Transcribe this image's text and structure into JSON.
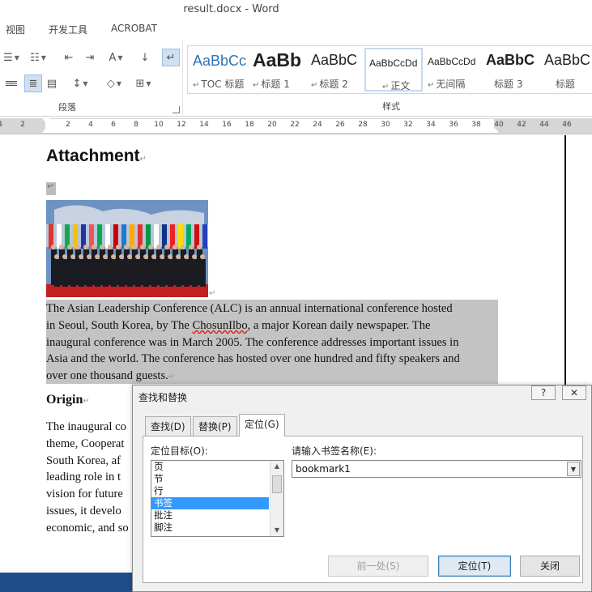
{
  "window": {
    "title": "result.docx - Word"
  },
  "ribbon_tabs": [
    "视图",
    "开发工具",
    "ACROBAT"
  ],
  "paragraph_group": {
    "label": "段落"
  },
  "styles_group": {
    "label": "样式",
    "items": [
      {
        "sample": "AaBbCc",
        "name": "TOC 标题"
      },
      {
        "sample": "AaBb",
        "name": "标题 1"
      },
      {
        "sample": "AaBbC",
        "name": "标题 2"
      },
      {
        "sample": "AaBbCcDd",
        "name": "正文"
      },
      {
        "sample": "AaBbCcDd",
        "name": "无间隔"
      },
      {
        "sample": "AaBbC",
        "name": "标题 3"
      },
      {
        "sample": "AaBbC",
        "name": "标题"
      }
    ]
  },
  "ruler": {
    "ticks": [
      "4",
      "2",
      "2",
      "4",
      "6",
      "8",
      "10",
      "12",
      "14",
      "16",
      "18",
      "20",
      "22",
      "24",
      "26",
      "28",
      "30",
      "32",
      "34",
      "36",
      "38",
      "40",
      "42",
      "44",
      "46"
    ]
  },
  "document": {
    "heading": "Attachment",
    "para1_lines": [
      "The Asian Leadership Conference (ALC) is an annual international conference hosted",
      "in Seoul, South Korea, by The ",
      "inaugural conference was in March 2005. The conference addresses important issues in",
      "Asia and the world. The conference has hosted over one hundred and fifty speakers and",
      "over one thousand guests."
    ],
    "para1_misspelled": "ChosunIlbo",
    "para1_line2_tail": ", a major Korean daily newspaper. The",
    "subheading": "Origin",
    "para2_lines": [
      "The inaugural co",
      "theme, Cooperat",
      "South Korea, af",
      "leading role in t",
      "vision for future",
      "issues, it develo",
      "economic, and so"
    ]
  },
  "dialog": {
    "title": "查找和替换",
    "help": "?",
    "close_glyph": "✕",
    "tabs": [
      "查找(D)",
      "替换(P)",
      "定位(G)"
    ],
    "goto_target_label": "定位目标(O):",
    "goto_targets": [
      "页",
      "节",
      "行",
      "书签",
      "批注",
      "脚注"
    ],
    "selected_target": "书签",
    "bookmark_label": "请输入书签名称(E):",
    "bookmark_value": "bookmark1",
    "buttons": {
      "previous": "前一处(S)",
      "goto": "定位(T)",
      "close": "关闭"
    }
  },
  "colors": {
    "selection": "#c3c3c3",
    "list_highlight": "#3399ff",
    "taskbar": "#1f4f8b"
  }
}
